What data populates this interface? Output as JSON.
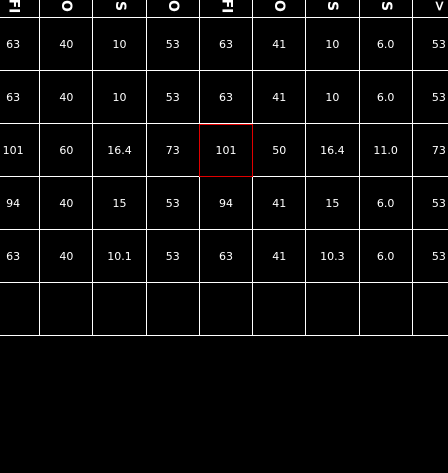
{
  "header": [
    "FI",
    "O",
    "S",
    "O",
    "FI",
    "O",
    "S",
    "S",
    ">"
  ],
  "rows": [
    [
      "63",
      "40",
      "10",
      "53",
      "63",
      "41",
      "10",
      "6.0",
      "53"
    ],
    [
      "63",
      "40",
      "10",
      "53",
      "63",
      "41",
      "10",
      "6.0",
      "53"
    ],
    [
      "101",
      "60",
      "16.4",
      "73",
      "101",
      "50",
      "16.4",
      "11.0",
      "73"
    ],
    [
      "94",
      "40",
      "15",
      "53",
      "94",
      "41",
      "15",
      "6.0",
      "53"
    ],
    [
      "63",
      "40",
      "10.1",
      "53",
      "63",
      "41",
      "10.3",
      "6.0",
      "53"
    ]
  ],
  "highlight_color": "#e00000",
  "background": "#000000",
  "grid_color": "#ffffff"
}
